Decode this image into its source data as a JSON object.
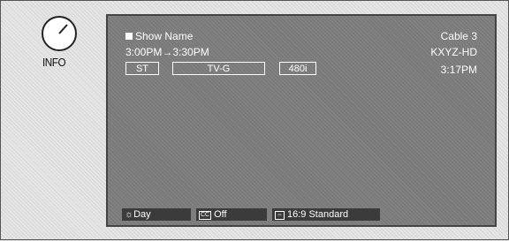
{
  "info_button": {
    "label": "INFO"
  },
  "banner": {
    "show_name": "Show Name",
    "cable": "Cable 3",
    "time_range": "3:00PM→3:30PM",
    "station": "KXYZ-HD",
    "clock": "3:17PM",
    "badges": {
      "audio": "ST",
      "rating": "TV-G",
      "resolution": "480i"
    }
  },
  "bottom_bar": {
    "day_label": "Day",
    "cc_label": "Off",
    "aspect_label": "16:9 Standard"
  },
  "icons": [
    "info-knob-icon",
    "sun-icon",
    "cc-icon",
    "aspect-icon"
  ],
  "colors": {
    "screen": "#7a7a7a",
    "bar": "#3b3b3b",
    "text": "#ffffff"
  }
}
